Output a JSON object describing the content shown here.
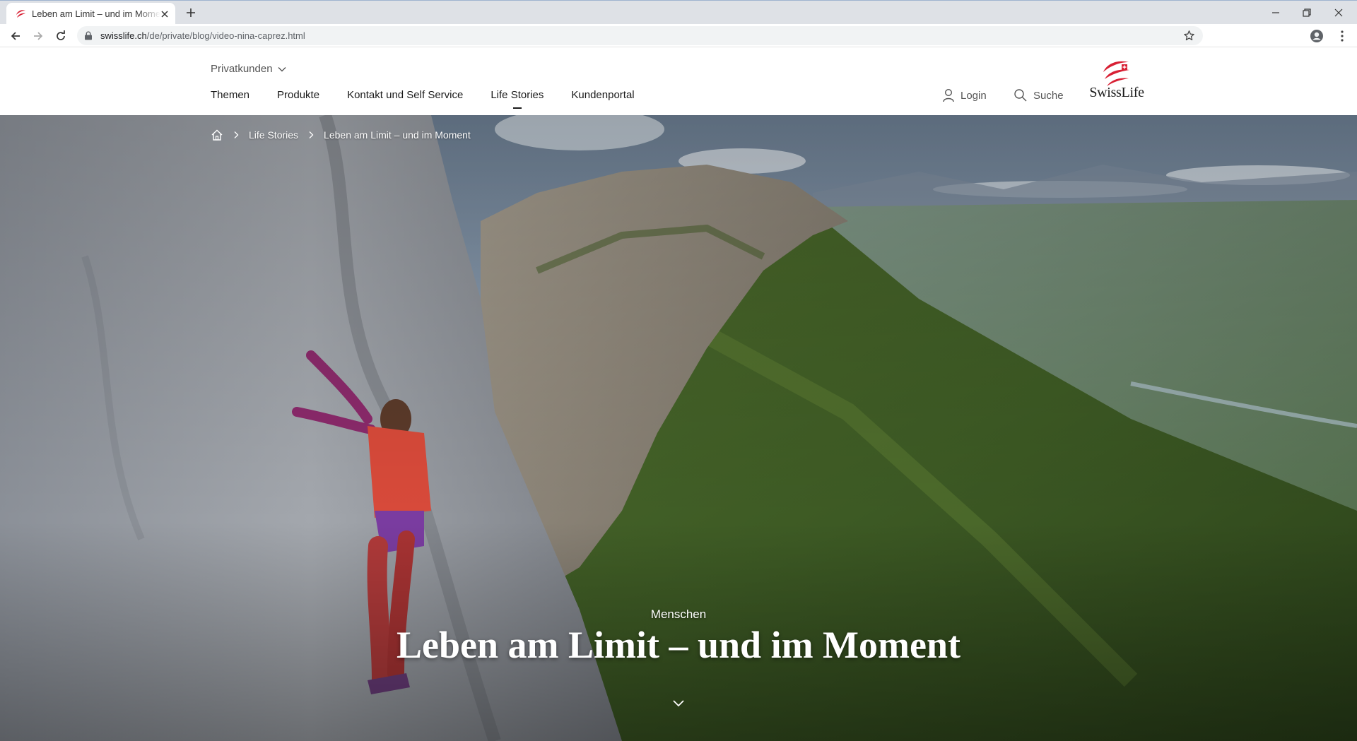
{
  "browser": {
    "tab_title": "Leben am Limit – und im Moment",
    "url_host": "swisslife.ch",
    "url_path": "/de/private/blog/video-nina-caprez.html"
  },
  "header": {
    "segment_label": "Privatkunden",
    "nav": [
      "Themen",
      "Produkte",
      "Kontakt und Self Service",
      "Life Stories",
      "Kundenportal"
    ],
    "active_nav": "Life Stories",
    "login_label": "Login",
    "search_label": "Suche",
    "logo_text": "SwissLife"
  },
  "hero": {
    "breadcrumb": [
      "Life Stories",
      "Leben am Limit – und im Moment"
    ],
    "kicker": "Menschen",
    "title": "Leben am Limit – und im Moment"
  },
  "colors": {
    "brand_red": "#d82034",
    "tab_strip": "#dee1e6",
    "omnibox": "#f1f3f4"
  },
  "icons": [
    "swisslife-favicon-icon",
    "close-icon",
    "plus-icon",
    "minimize-icon",
    "restore-icon",
    "window-close-icon",
    "back-arrow-icon",
    "forward-arrow-icon",
    "reload-icon",
    "lock-icon",
    "star-icon",
    "profile-icon",
    "kebab-menu-icon",
    "chevron-down-icon",
    "user-icon",
    "search-icon",
    "home-icon",
    "chevron-right-icon"
  ]
}
